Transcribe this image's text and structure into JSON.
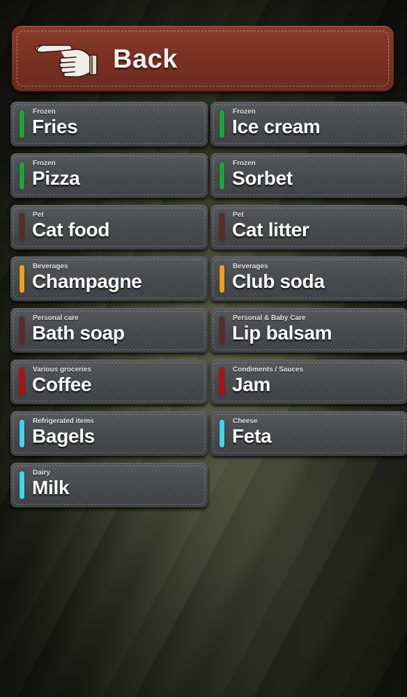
{
  "back_button": {
    "label": "Back",
    "icon": "pointing-hand-icon"
  },
  "items": [
    {
      "category": "Frozen",
      "name": "Fries",
      "color": "#1fa23a"
    },
    {
      "category": "Frozen",
      "name": "Ice cream",
      "color": "#1fa23a"
    },
    {
      "category": "Frozen",
      "name": "Pizza",
      "color": "#1fa23a"
    },
    {
      "category": "Frozen",
      "name": "Sorbet",
      "color": "#1fa23a"
    },
    {
      "category": "Pet",
      "name": "Cat food",
      "color": "#5a2a2c"
    },
    {
      "category": "Pet",
      "name": "Cat litter",
      "color": "#5a2a2c"
    },
    {
      "category": "Beverages",
      "name": "Champagne",
      "color": "#f0a01a"
    },
    {
      "category": "Beverages",
      "name": "Club soda",
      "color": "#f0a01a"
    },
    {
      "category": "Personal care",
      "name": "Bath soap",
      "color": "#5a2a2c"
    },
    {
      "category": "Personal & Baby Care",
      "name": "Lip balsam",
      "color": "#5a2a2c"
    },
    {
      "category": "Various groceries",
      "name": "Coffee",
      "color": "#b50f0f"
    },
    {
      "category": "Condiments / Sauces",
      "name": "Jam",
      "color": "#b50f0f"
    },
    {
      "category": "Refrigerated items",
      "name": "Bagels",
      "color": "#3fd6ea"
    },
    {
      "category": "Cheese",
      "name": "Feta",
      "color": "#3fd6ea"
    },
    {
      "category": "Dairy",
      "name": "Milk",
      "color": "#3fd6ea"
    }
  ]
}
